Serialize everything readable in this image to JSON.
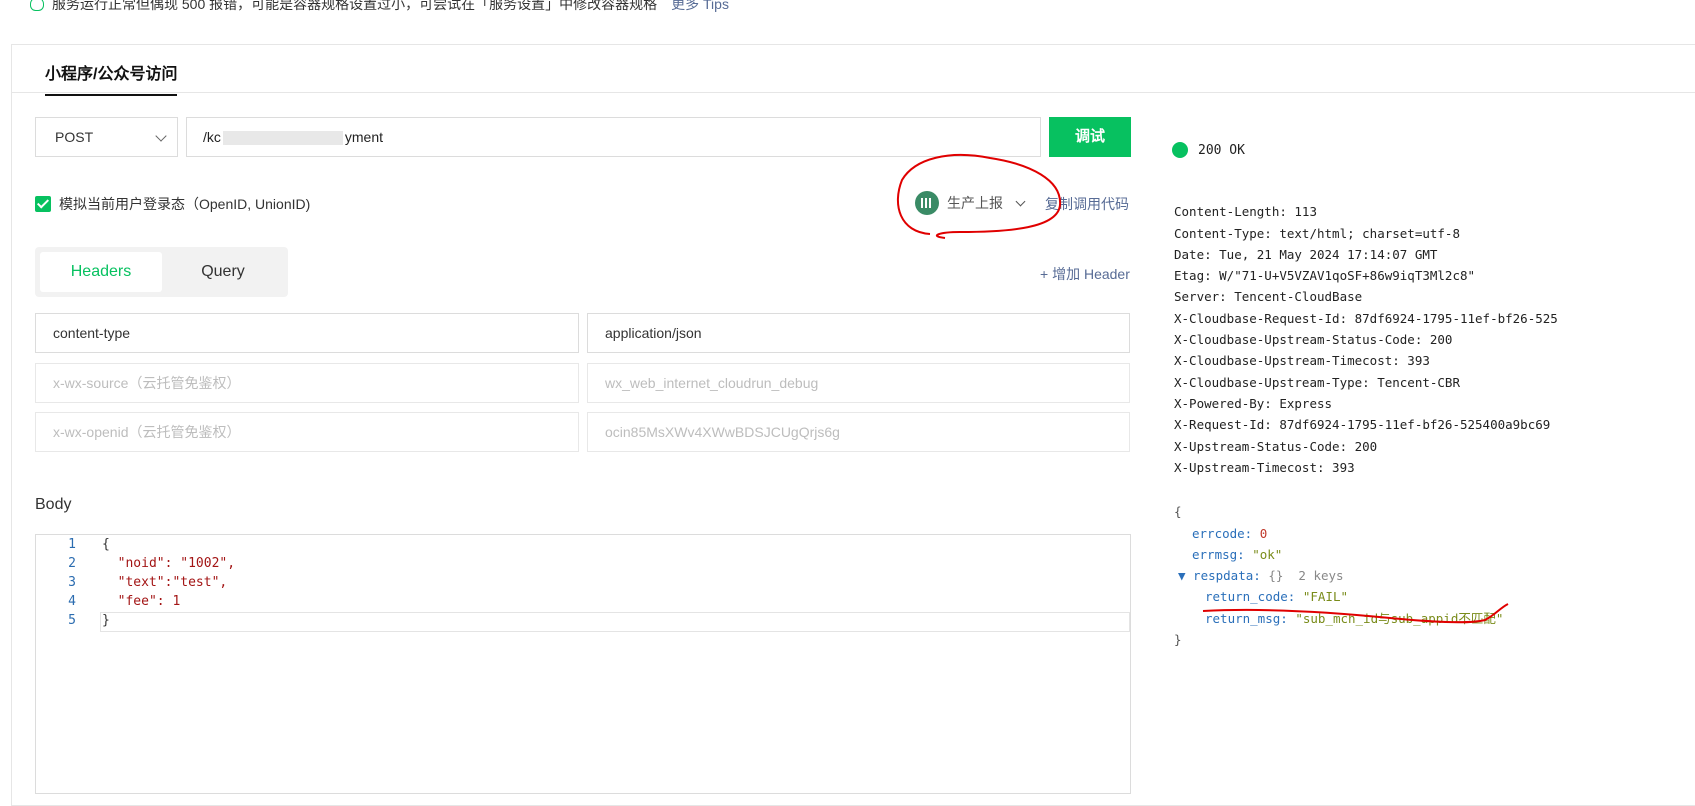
{
  "notice": {
    "text": "服务运行正常但偶现 500 报错，可能是容器规格设置过小，可尝试在「服务设置」中修改容器规格",
    "link": "更多 Tips"
  },
  "tab": {
    "label": "小程序/公众号访问"
  },
  "request": {
    "method": "POST",
    "url_prefix": "/kc",
    "url_suffix": "yment",
    "debug_label": "调试",
    "simulate_login_label": "模拟当前用户登录态（OpenID, UnionID)",
    "simulate_login_checked": true,
    "environment_label": "生产上报",
    "copy_code_label": "复制调用代码"
  },
  "segments": {
    "headers": "Headers",
    "query": "Query",
    "add_header": "+ 增加 Header"
  },
  "headers": [
    {
      "key": "content-type",
      "value": "application/json",
      "placeholder": false
    },
    {
      "key": "x-wx-source（云托管免鉴权）",
      "value": "wx_web_internet_cloudrun_debug",
      "placeholder": true
    },
    {
      "key": "x-wx-openid（云托管免鉴权）",
      "value": "ocin85MsXWv4XWwBDSJCUgQrjs6g",
      "placeholder": true
    }
  ],
  "body": {
    "label": "Body",
    "line_numbers": [
      "1",
      "2",
      "3",
      "4",
      "5"
    ],
    "lines": [
      "{",
      "  \"noid\": \"1002\",",
      "  \"text\":\"test\",",
      "  \"fee\": 1",
      "}"
    ]
  },
  "response": {
    "status": "200 OK",
    "status_color": "#07c160",
    "headers": [
      "Content-Length: 113",
      "Content-Type: text/html; charset=utf-8",
      "Date: Tue, 21 May 2024 17:14:07 GMT",
      "Etag: W/\"71-U+V5VZAV1qoSF+86w9iqT3Ml2c8\"",
      "Server: Tencent-CloudBase",
      "X-Cloudbase-Request-Id: 87df6924-1795-11ef-bf26-525",
      "X-Cloudbase-Upstream-Status-Code: 200",
      "X-Cloudbase-Upstream-Timecost: 393",
      "X-Cloudbase-Upstream-Type: Tencent-CBR",
      "X-Powered-By: Express",
      "X-Request-Id: 87df6924-1795-11ef-bf26-525400a9bc69",
      "X-Upstream-Status-Code: 200",
      "X-Upstream-Timecost: 393"
    ],
    "json": {
      "open": "{",
      "errcode_key": "errcode:",
      "errcode": "0",
      "errmsg_key": "errmsg:",
      "errmsg": "\"ok\"",
      "respdata_key": "▼ respdata:",
      "respdata_meta": "{}  2 keys",
      "return_code_key": "return_code:",
      "return_code": "\"FAIL\"",
      "return_msg_key": "return_msg:",
      "return_msg": "\"sub_mch_id与sub_appid不匹配\"",
      "close": "}"
    }
  },
  "icons": {
    "bulb": "lightbulb-icon",
    "env": "building-icon",
    "dropdown": "chevron-down-icon",
    "check": "checkbox-icon"
  },
  "accent_color": "#07c160",
  "link_color": "#576b95",
  "annotation_color": "#e00000"
}
